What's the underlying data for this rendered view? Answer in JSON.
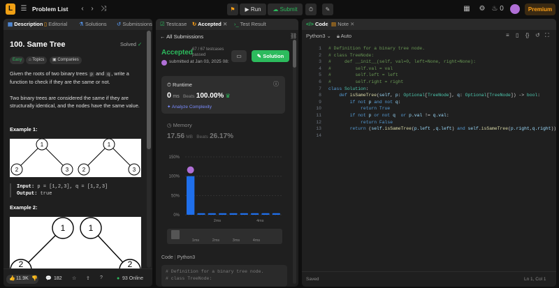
{
  "topbar": {
    "logo": "L",
    "problem_list": "Problem List",
    "run": "Run",
    "submit": "Submit",
    "streak": "0",
    "premium": "Premium"
  },
  "left": {
    "tabs": [
      "Description",
      "Editorial",
      "Solutions",
      "Submissions"
    ],
    "title": "100. Same Tree",
    "solved": "Solved",
    "pills": [
      "Easy",
      "Topics",
      "Companies"
    ],
    "para1_a": "Given the roots of two binary trees ",
    "para1_p": "p",
    "para1_and": " and ",
    "para1_q": "q",
    "para1_b": ", write a function to check if they are the same or not.",
    "para2": "Two binary trees are considered the same if they are structurally identical, and the nodes have the same value.",
    "example1": "Example 1:",
    "example1_input_label": "Input:",
    "example1_input": "p = [1,2,3], q = [1,2,3]",
    "example1_output_label": "Output:",
    "example1_output": "true",
    "example2": "Example 2:",
    "tree1_nodes": [
      "1",
      "2",
      "3"
    ],
    "tree2_nodes": [
      "1",
      "1",
      "2",
      "2"
    ],
    "footer": {
      "likes": "11.9K",
      "comments": "182",
      "online": "93 Online"
    }
  },
  "mid": {
    "tabs": [
      "Testcase",
      "Accepted",
      "Test Result"
    ],
    "all_submissions": "All Submissions",
    "status": "Accepted",
    "testcases": "67 / 67 testcases passed",
    "solution": "Solution",
    "submitted": "submitted at Jan 03, 2025 08:",
    "runtime": {
      "label": "Runtime",
      "value": "0",
      "unit": "ms",
      "beats_label": "Beats",
      "beats": "100.00%",
      "analyze": "Analyze Complexity"
    },
    "memory": {
      "label": "Memory",
      "value": "17.56",
      "unit": "MB",
      "beats_label": "Beats",
      "beats": "26.17%"
    },
    "chart_data": {
      "type": "bar",
      "ytick_labels": [
        "150%",
        "100%",
        "50%",
        "0%"
      ],
      "ylim": [
        0,
        150
      ],
      "values": [
        100,
        4,
        4,
        4,
        4,
        4,
        4,
        4,
        4
      ],
      "xtick_labels": [
        "2ms",
        "4ms"
      ],
      "bottom_labels": [
        "1ms",
        "2ms",
        "3ms",
        "4ms"
      ]
    },
    "code_label": "Code",
    "code_lang": "Python3",
    "code_preview": [
      "# Definition for a binary tree node.",
      "# class TreeNode:"
    ]
  },
  "right": {
    "tabs": [
      "Code",
      "Note"
    ],
    "lang": "Python3",
    "auto": "Auto",
    "code_lines": [
      [
        [
          "cm",
          "# Definition for a binary tree node."
        ]
      ],
      [
        [
          "cm",
          "# class TreeNode:"
        ]
      ],
      [
        [
          "cm",
          "#     def __init__(self, val=0, left=None, right=None):"
        ]
      ],
      [
        [
          "cm",
          "#         self.val = val"
        ]
      ],
      [
        [
          "cm",
          "#         self.left = left"
        ]
      ],
      [
        [
          "cm",
          "#         self.right = right"
        ]
      ],
      [
        [
          "kw",
          "class "
        ],
        [
          "ty",
          "Solution"
        ],
        [
          "op",
          ":"
        ]
      ],
      [
        [
          "op",
          "    "
        ],
        [
          "kw",
          "def "
        ],
        [
          "fn",
          "isSameTree"
        ],
        [
          "op",
          "("
        ],
        [
          "tx",
          "self"
        ],
        [
          "op",
          ", "
        ],
        [
          "tx",
          "p"
        ],
        [
          "op",
          ": "
        ],
        [
          "ty",
          "Optional"
        ],
        [
          "op",
          "["
        ],
        [
          "ty",
          "TreeNode"
        ],
        [
          "op",
          "], "
        ],
        [
          "tx",
          "q"
        ],
        [
          "op",
          ": "
        ],
        [
          "ty",
          "Optional"
        ],
        [
          "op",
          "["
        ],
        [
          "ty",
          "TreeNode"
        ],
        [
          "op",
          "]) -> "
        ],
        [
          "ty",
          "bool"
        ],
        [
          "op",
          ":"
        ]
      ],
      [
        [
          "op",
          "        "
        ],
        [
          "kw",
          "if not "
        ],
        [
          "tx",
          "p "
        ],
        [
          "kw",
          "and not "
        ],
        [
          "tx",
          "q"
        ],
        [
          "op",
          ":"
        ]
      ],
      [
        [
          "op",
          "            "
        ],
        [
          "kw",
          "return "
        ],
        [
          "kw",
          "True"
        ]
      ],
      [
        [
          "op",
          "        "
        ],
        [
          "kw",
          "if not "
        ],
        [
          "tx",
          "p "
        ],
        [
          "kw",
          "or not "
        ],
        [
          "tx",
          "q  "
        ],
        [
          "kw",
          "or "
        ],
        [
          "tx",
          "p.val "
        ],
        [
          "op",
          "!= "
        ],
        [
          "tx",
          "q.val"
        ],
        [
          "op",
          ":"
        ]
      ],
      [
        [
          "op",
          "            "
        ],
        [
          "kw",
          "return "
        ],
        [
          "kw",
          "False"
        ]
      ],
      [
        [
          "op",
          "        "
        ],
        [
          "kw",
          "return "
        ],
        [
          "op",
          "("
        ],
        [
          "tx",
          "self"
        ],
        [
          "op",
          "."
        ],
        [
          "fn",
          "isSameTree"
        ],
        [
          "op",
          "("
        ],
        [
          "tx",
          "p.left "
        ],
        [
          "op",
          ","
        ],
        [
          "tx",
          "q.left"
        ],
        [
          "op",
          ") "
        ],
        [
          "kw",
          "and "
        ],
        [
          "tx",
          "self"
        ],
        [
          "op",
          "."
        ],
        [
          "fn",
          "isSameTree"
        ],
        [
          "op",
          "("
        ],
        [
          "tx",
          "p.right"
        ],
        [
          "op",
          ","
        ],
        [
          "tx",
          "q.right"
        ],
        [
          "op",
          "))"
        ]
      ],
      []
    ],
    "saved": "Saved",
    "cursor": "Ln 1, Col 1"
  }
}
